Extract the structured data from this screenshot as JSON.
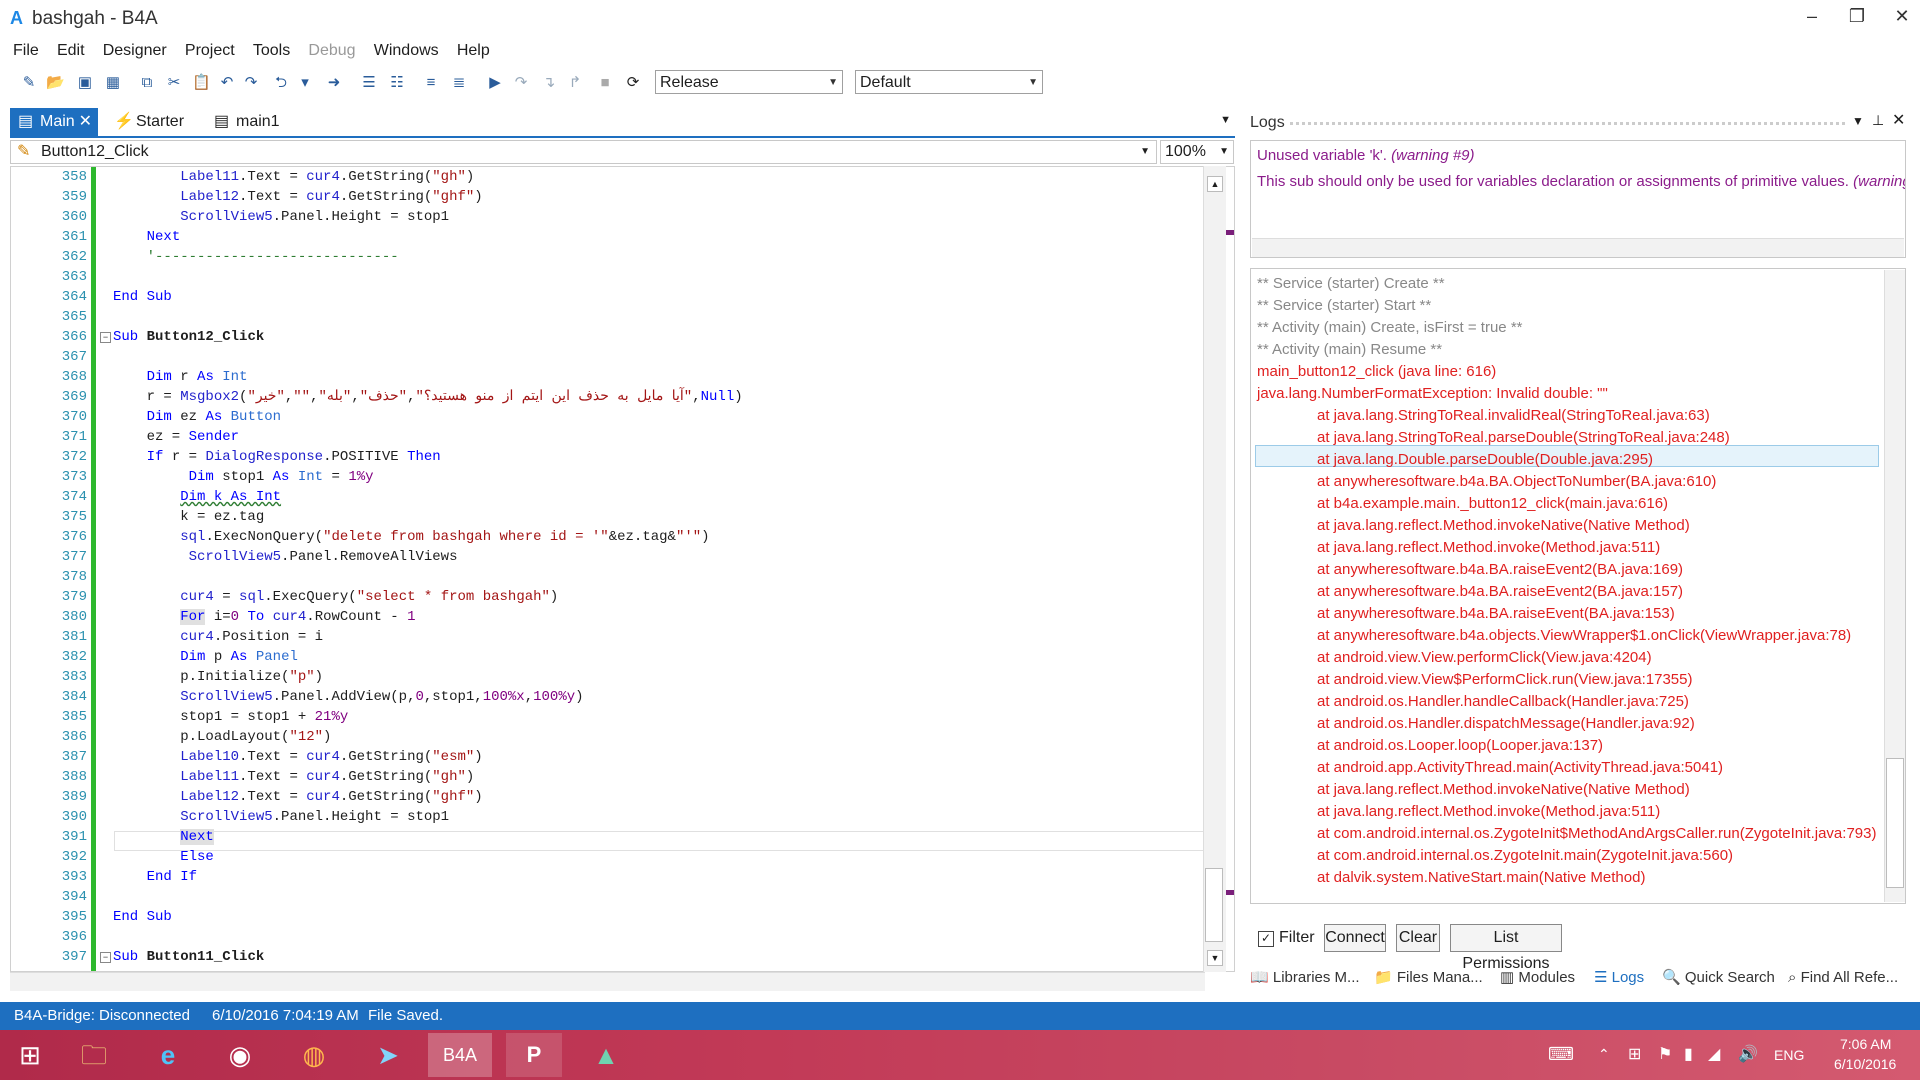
{
  "window": {
    "logo": "A",
    "title": "bashgah - B4A",
    "minimize": "–",
    "restore": "❐",
    "close": "✕"
  },
  "menu": [
    {
      "label": "File",
      "disabled": false
    },
    {
      "label": "Edit",
      "disabled": false
    },
    {
      "label": "Designer",
      "disabled": false
    },
    {
      "label": "Project",
      "disabled": false
    },
    {
      "label": "Tools",
      "disabled": false
    },
    {
      "label": "Debug",
      "disabled": true
    },
    {
      "label": "Windows",
      "disabled": false
    },
    {
      "label": "Help",
      "disabled": false
    }
  ],
  "toolbar": {
    "build_config": "Release",
    "device": "Default"
  },
  "tabs": [
    {
      "label": "Main",
      "active": true
    },
    {
      "label": "Starter",
      "active": false
    },
    {
      "label": "main1",
      "active": false
    }
  ],
  "editor": {
    "sub_selector": "Button12_Click",
    "zoom": "100%",
    "line_numbers": [
      "358",
      "359",
      "360",
      "361",
      "362",
      "363",
      "364",
      "365",
      "366",
      "367",
      "368",
      "369",
      "370",
      "371",
      "372",
      "373",
      "374",
      "375",
      "376",
      "377",
      "378",
      "379",
      "380",
      "381",
      "382",
      "383",
      "384",
      "385",
      "386",
      "387",
      "388",
      "389",
      "390",
      "391",
      "392",
      "393",
      "394",
      "395",
      "396",
      "397"
    ]
  },
  "logs": {
    "title": "Logs",
    "warnings": [
      {
        "text": "Unused variable 'k'.",
        "note": "(warning #9)"
      },
      {
        "text": "This sub should only be used for variables declaration or assignments of primitive values.",
        "note": "(warning"
      }
    ],
    "lines": [
      {
        "text": "** Service (starter) Create **",
        "style": "gray",
        "indent": false
      },
      {
        "text": "** Service (starter) Start **",
        "style": "gray",
        "indent": false
      },
      {
        "text": "** Activity (main) Create, isFirst = true **",
        "style": "gray",
        "indent": false
      },
      {
        "text": "** Activity (main) Resume **",
        "style": "gray",
        "indent": false
      },
      {
        "text": "main_button12_click (java line: 616)",
        "style": "red",
        "indent": false
      },
      {
        "text": "java.lang.NumberFormatException: Invalid double: \"\"",
        "style": "red",
        "indent": false
      },
      {
        "text": "at java.lang.StringToReal.invalidReal(StringToReal.java:63)",
        "style": "red",
        "indent": true
      },
      {
        "text": "at java.lang.StringToReal.parseDouble(StringToReal.java:248)",
        "style": "red",
        "indent": true
      },
      {
        "text": "at java.lang.Double.parseDouble(Double.java:295)",
        "style": "red",
        "indent": true
      },
      {
        "text": "at anywheresoftware.b4a.BA.ObjectToNumber(BA.java:610)",
        "style": "red",
        "indent": true
      },
      {
        "text": "at b4a.example.main._button12_click(main.java:616)",
        "style": "red",
        "indent": true
      },
      {
        "text": "at java.lang.reflect.Method.invokeNative(Native Method)",
        "style": "red",
        "indent": true
      },
      {
        "text": "at java.lang.reflect.Method.invoke(Method.java:511)",
        "style": "red",
        "indent": true
      },
      {
        "text": "at anywheresoftware.b4a.BA.raiseEvent2(BA.java:169)",
        "style": "red",
        "indent": true
      },
      {
        "text": "at anywheresoftware.b4a.BA.raiseEvent2(BA.java:157)",
        "style": "red",
        "indent": true
      },
      {
        "text": "at anywheresoftware.b4a.BA.raiseEvent(BA.java:153)",
        "style": "red",
        "indent": true
      },
      {
        "text": "at anywheresoftware.b4a.objects.ViewWrapper$1.onClick(ViewWrapper.java:78)",
        "style": "red",
        "indent": true
      },
      {
        "text": "at android.view.View.performClick(View.java:4204)",
        "style": "red",
        "indent": true
      },
      {
        "text": "at android.view.View$PerformClick.run(View.java:17355)",
        "style": "red",
        "indent": true
      },
      {
        "text": "at android.os.Handler.handleCallback(Handler.java:725)",
        "style": "red",
        "indent": true
      },
      {
        "text": "at android.os.Handler.dispatchMessage(Handler.java:92)",
        "style": "red",
        "indent": true
      },
      {
        "text": "at android.os.Looper.loop(Looper.java:137)",
        "style": "red",
        "indent": true
      },
      {
        "text": "at android.app.ActivityThread.main(ActivityThread.java:5041)",
        "style": "red",
        "indent": true
      },
      {
        "text": "at java.lang.reflect.Method.invokeNative(Native Method)",
        "style": "red",
        "indent": true
      },
      {
        "text": "at java.lang.reflect.Method.invoke(Method.java:511)",
        "style": "red",
        "indent": true
      },
      {
        "text": "at com.android.internal.os.ZygoteInit$MethodAndArgsCaller.run(ZygoteInit.java:793)",
        "style": "red",
        "indent": true
      },
      {
        "text": "at com.android.internal.os.ZygoteInit.main(ZygoteInit.java:560)",
        "style": "red",
        "indent": true
      },
      {
        "text": "at dalvik.system.NativeStart.main(Native Method)",
        "style": "red",
        "indent": true
      }
    ],
    "filter_label": "Filter",
    "filter_checked": true,
    "buttons": [
      "Connect",
      "Clear",
      "List Permissions"
    ]
  },
  "panel_tabs": [
    {
      "label": "Libraries M...",
      "icon": "book-icon",
      "active": false
    },
    {
      "label": "Files Mana...",
      "icon": "folder-icon",
      "active": false
    },
    {
      "label": "Modules",
      "icon": "modules-icon",
      "active": false
    },
    {
      "label": "Logs",
      "icon": "logs-icon",
      "active": true
    },
    {
      "label": "Quick Search",
      "icon": "search-icon",
      "active": false
    },
    {
      "label": "Find All Refe...",
      "icon": "find-icon",
      "active": false
    }
  ],
  "status": {
    "bridge": "B4A-Bridge: Disconnected",
    "timestamp": "6/10/2016 7:04:19 AM",
    "message": "File Saved."
  },
  "taskbar": {
    "apps": [
      "windows-start-icon",
      "file-explorer-icon",
      "internet-explorer-icon",
      "chrome-icon",
      "firefox-icon",
      "telegram-icon",
      "b4a-icon",
      "powerpoint-icon",
      "app-icon"
    ],
    "b4a_label": "B4A",
    "ppt_label": "P",
    "language": "ENG",
    "time": "7:06 AM",
    "date": "6/10/2016"
  },
  "colors": {
    "accent": "#1e6fc0",
    "error": "#e02020",
    "warning": "#8b1c8b",
    "keyword": "#0000ff",
    "string": "#a31515",
    "comment": "#2e7d32",
    "taskbar": "#c23a57",
    "change_bar": "#2eb82e"
  }
}
